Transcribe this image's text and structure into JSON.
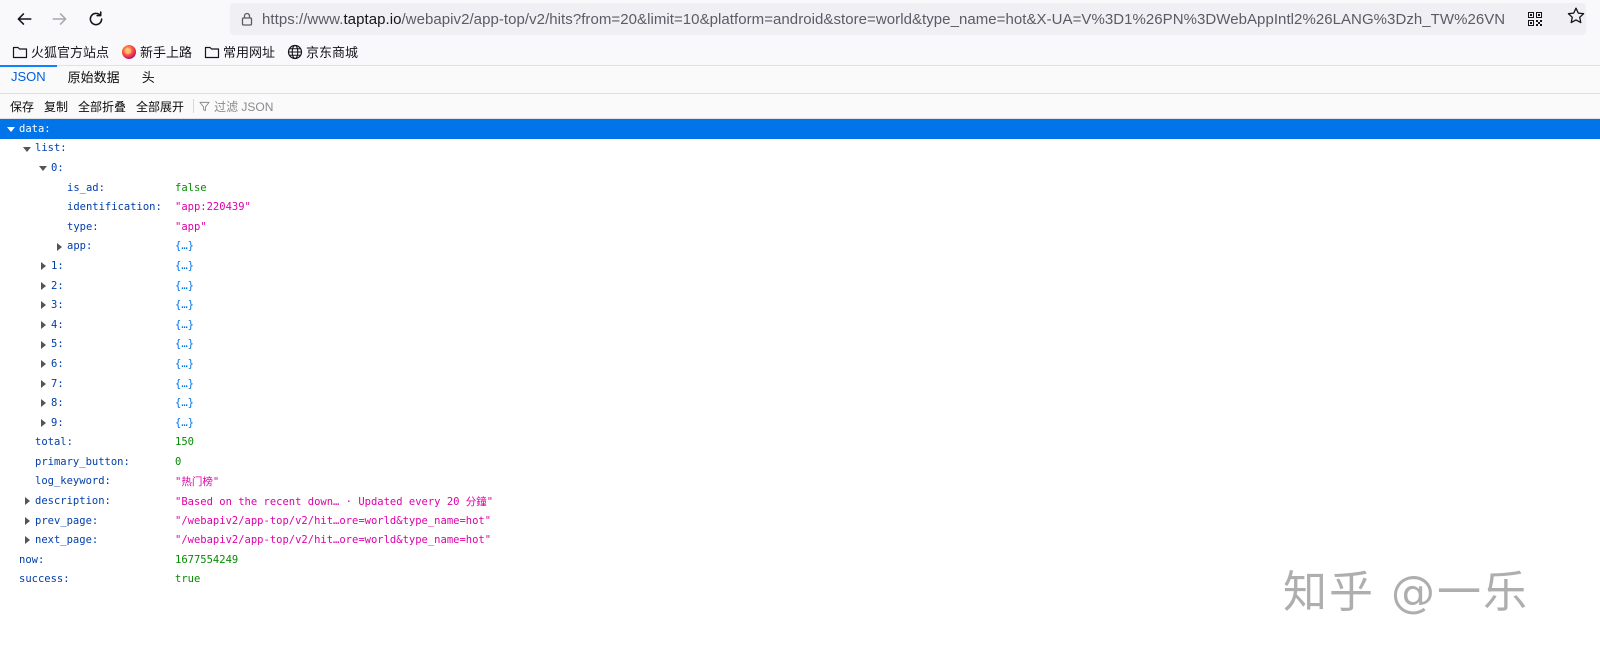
{
  "navbar": {
    "url_scheme": "https://www.",
    "url_host": "taptap.io",
    "url_rest": "/webapiv2/app-top/v2/hits?from=20&limit=10&platform=android&store=world&type_name=hot&X-UA=V%3D1%26PN%3DWebAppIntl2%26LANG%3Dzh_TW%26VN"
  },
  "bookmarks": [
    {
      "label": "火狐官方站点",
      "icon": "folder-icon"
    },
    {
      "label": "新手上路",
      "icon": "firefox-icon"
    },
    {
      "label": "常用网址",
      "icon": "folder-icon"
    },
    {
      "label": "京东商城",
      "icon": "globe-icon"
    }
  ],
  "tabs": [
    {
      "label": "JSON",
      "active": true
    },
    {
      "label": "原始数据",
      "active": false
    },
    {
      "label": "头",
      "active": false
    }
  ],
  "toolbar": {
    "save": "保存",
    "copy": "复制",
    "collapse_all": "全部折叠",
    "expand_all": "全部展开",
    "filter_placeholder": "过滤 JSON"
  },
  "tree": [
    {
      "key": "data:",
      "depth": 0,
      "twisty": "open",
      "value": "",
      "type": "",
      "selected": true
    },
    {
      "key": "list:",
      "depth": 1,
      "twisty": "open",
      "value": "",
      "type": ""
    },
    {
      "key": "0:",
      "depth": 2,
      "twisty": "open",
      "value": "",
      "type": ""
    },
    {
      "key": "is_ad:",
      "depth": 3,
      "twisty": "",
      "value": "false",
      "type": "bool"
    },
    {
      "key": "identification:",
      "depth": 3,
      "twisty": "",
      "value": "\"app:220439\"",
      "type": "str"
    },
    {
      "key": "type:",
      "depth": 3,
      "twisty": "",
      "value": "\"app\"",
      "type": "str"
    },
    {
      "key": "app:",
      "depth": 3,
      "twisty": "closed",
      "value": "{…}",
      "type": "obj"
    },
    {
      "key": "1:",
      "depth": 2,
      "twisty": "closed",
      "value": "{…}",
      "type": "obj"
    },
    {
      "key": "2:",
      "depth": 2,
      "twisty": "closed",
      "value": "{…}",
      "type": "obj"
    },
    {
      "key": "3:",
      "depth": 2,
      "twisty": "closed",
      "value": "{…}",
      "type": "obj"
    },
    {
      "key": "4:",
      "depth": 2,
      "twisty": "closed",
      "value": "{…}",
      "type": "obj"
    },
    {
      "key": "5:",
      "depth": 2,
      "twisty": "closed",
      "value": "{…}",
      "type": "obj"
    },
    {
      "key": "6:",
      "depth": 2,
      "twisty": "closed",
      "value": "{…}",
      "type": "obj"
    },
    {
      "key": "7:",
      "depth": 2,
      "twisty": "closed",
      "value": "{…}",
      "type": "obj"
    },
    {
      "key": "8:",
      "depth": 2,
      "twisty": "closed",
      "value": "{…}",
      "type": "obj"
    },
    {
      "key": "9:",
      "depth": 2,
      "twisty": "closed",
      "value": "{…}",
      "type": "obj"
    },
    {
      "key": "total:",
      "depth": 1,
      "twisty": "",
      "value": "150",
      "type": "num"
    },
    {
      "key": "primary_button:",
      "depth": 1,
      "twisty": "",
      "value": "0",
      "type": "num"
    },
    {
      "key": "log_keyword:",
      "depth": 1,
      "twisty": "",
      "value": "\"热门榜\"",
      "type": "str"
    },
    {
      "key": "description:",
      "depth": 1,
      "twisty": "closed",
      "value": "\"Based on the recent down… · Updated every  20 分鐘\"",
      "type": "str"
    },
    {
      "key": "prev_page:",
      "depth": 1,
      "twisty": "closed",
      "value": "\"/webapiv2/app-top/v2/hit…ore=world&type_name=hot\"",
      "type": "str"
    },
    {
      "key": "next_page:",
      "depth": 1,
      "twisty": "closed",
      "value": "\"/webapiv2/app-top/v2/hit…ore=world&type_name=hot\"",
      "type": "str"
    },
    {
      "key": "now:",
      "depth": 0,
      "twisty": "",
      "value": "1677554249",
      "type": "num"
    },
    {
      "key": "success:",
      "depth": 0,
      "twisty": "",
      "value": "true",
      "type": "bool"
    }
  ],
  "watermark": "知乎 @一乐"
}
